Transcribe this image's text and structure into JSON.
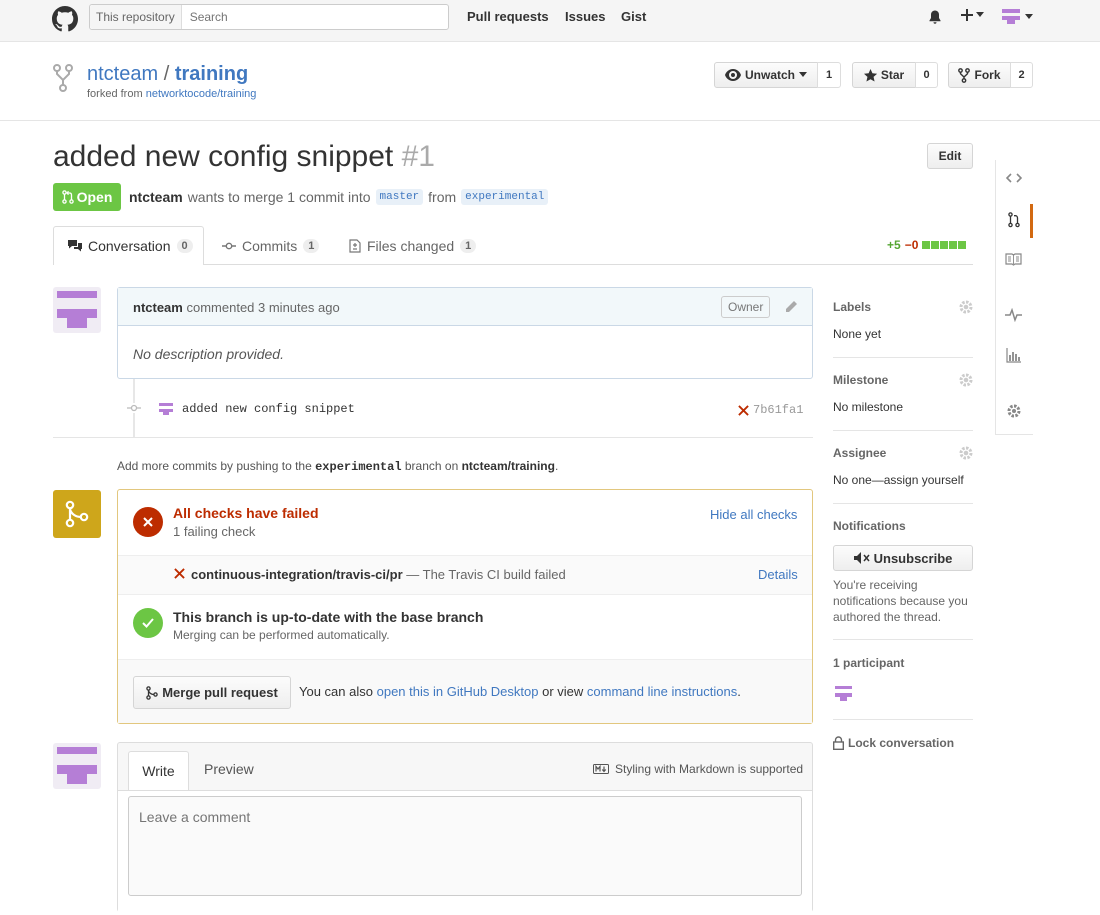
{
  "header": {
    "search_scope": "This repository",
    "search_placeholder": "Search",
    "nav": [
      "Pull requests",
      "Issues",
      "Gist"
    ]
  },
  "repo": {
    "owner": "ntcteam",
    "separator": "/",
    "name": "training",
    "forked_prefix": "forked from",
    "forked_from": "networktocode/training",
    "unwatch_label": "Unwatch",
    "unwatch_count": "1",
    "star_label": "Star",
    "star_count": "0",
    "fork_label": "Fork",
    "fork_count": "2"
  },
  "pr": {
    "title": "added new config snippet",
    "number": "#1",
    "edit_label": "Edit",
    "state": "Open",
    "author": "ntcteam",
    "meta_text": "wants to merge 1 commit into",
    "base_branch": "master",
    "from_text": "from",
    "head_branch": "experimental",
    "tabs": [
      {
        "label": "Conversation",
        "count": "0"
      },
      {
        "label": "Commits",
        "count": "1"
      },
      {
        "label": "Files changed",
        "count": "1"
      }
    ],
    "additions": "+5",
    "deletions": "−0"
  },
  "comment": {
    "author": "ntcteam",
    "action": "commented 3 minutes ago",
    "badge": "Owner",
    "body": "No description provided."
  },
  "commit": {
    "message": "added new config snippet",
    "sha": "7b61fa1"
  },
  "push_note": {
    "prefix": "Add more commits by pushing to the",
    "branch": "experimental",
    "middle": "branch on",
    "repo": "ntcteam/training",
    "suffix": "."
  },
  "checks": {
    "title": "All checks have failed",
    "subtitle": "1 failing check",
    "hide_label": "Hide all checks",
    "check_name": "continuous-integration/travis-ci/pr",
    "check_desc": "— The Travis CI build failed",
    "details_label": "Details",
    "uptodate_title": "This branch is up-to-date with the base branch",
    "uptodate_sub": "Merging can be performed automatically.",
    "merge_label": "Merge pull request",
    "also_text": "You can also",
    "desktop_link": "open this in GitHub Desktop",
    "or_text": "or view",
    "cli_link": "command line instructions",
    "end_text": "."
  },
  "editor": {
    "write_tab": "Write",
    "preview_tab": "Preview",
    "markdown_note": "Styling with Markdown is supported",
    "placeholder": "Leave a comment"
  },
  "sidebar": {
    "labels_title": "Labels",
    "labels_value": "None yet",
    "milestone_title": "Milestone",
    "milestone_value": "No milestone",
    "assignee_title": "Assignee",
    "assignee_value": "No one—assign yourself",
    "notifications_title": "Notifications",
    "unsubscribe_label": "Unsubscribe",
    "notif_text": "You're receiving notifications because you authored the thread.",
    "participants": "1 participant",
    "lock_label": "Lock conversation"
  },
  "colors": {
    "open_green": "#6cc644",
    "link_blue": "#4078c0",
    "fail_red": "#bd2c00",
    "success_green": "#6cc644",
    "warning_yellow": "#cea61b",
    "avatar_purple": "#b57ed6"
  },
  "icons": [
    "octocat-icon",
    "bell-icon",
    "plus-icon",
    "repo-forked-icon",
    "eye-icon",
    "star-icon",
    "git-pull-request-icon",
    "comment-icon",
    "git-commit-icon",
    "file-diff-icon",
    "pencil-icon",
    "x-icon",
    "check-icon",
    "git-merge-icon",
    "mute-icon",
    "lock-icon",
    "gear-icon",
    "code-icon",
    "book-icon",
    "pulse-icon",
    "graph-icon",
    "markdown-icon"
  ]
}
